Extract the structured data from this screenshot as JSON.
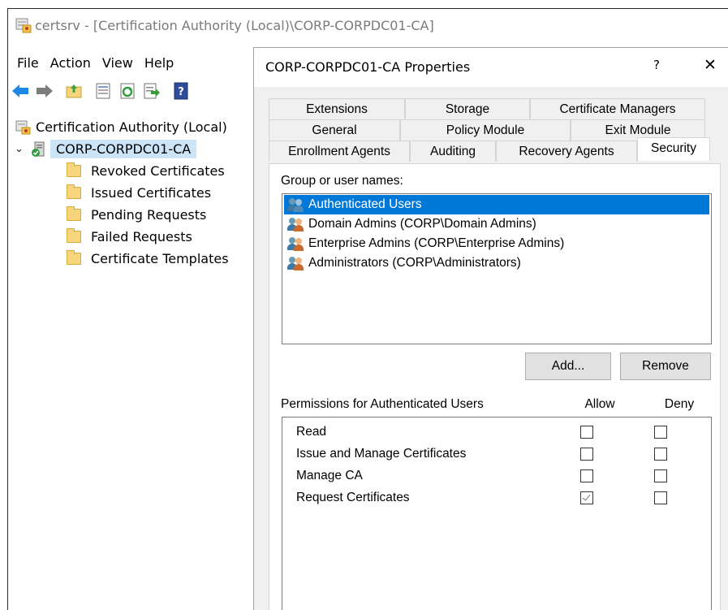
{
  "window": {
    "title": "certsrv - [Certification Authority (Local)\\CORP-CORPDC01-CA]",
    "icon": "certsrv-app-icon"
  },
  "menu": [
    "File",
    "Action",
    "View",
    "Help"
  ],
  "toolbar": {
    "icons": [
      "back-arrow-icon",
      "forward-arrow-icon",
      "up-folder-icon",
      "properties-icon",
      "refresh-icon",
      "export-list-icon",
      "help-icon"
    ]
  },
  "tree": {
    "root": "Certification Authority (Local)",
    "ca": "CORP-CORPDC01-CA",
    "folders": [
      "Revoked Certificates",
      "Issued Certificates",
      "Pending Requests",
      "Failed Requests",
      "Certificate Templates"
    ]
  },
  "dialog": {
    "title": "CORP-CORPDC01-CA Properties",
    "help_label": "?",
    "close_label": "✕",
    "tabs": {
      "row1": [
        "Extensions",
        "Storage",
        "Certificate Managers"
      ],
      "row2": [
        "General",
        "Policy Module",
        "Exit Module"
      ],
      "row3": [
        "Enrollment Agents",
        "Auditing",
        "Recovery Agents",
        "Security"
      ],
      "active": "Security"
    },
    "security": {
      "group_label": "Group or user names:",
      "users": [
        {
          "name": "Authenticated Users",
          "selected": true
        },
        {
          "name": "Domain Admins (CORP\\Domain Admins)",
          "selected": false
        },
        {
          "name": "Enterprise Admins (CORP\\Enterprise Admins)",
          "selected": false
        },
        {
          "name": "Administrators (CORP\\Administrators)",
          "selected": false
        }
      ],
      "add_label": "Add...",
      "remove_label": "Remove",
      "permissions_label": "Permissions for Authenticated Users",
      "allow_label": "Allow",
      "deny_label": "Deny",
      "permissions": [
        {
          "name": "Read",
          "allow": false,
          "deny": false
        },
        {
          "name": "Issue and Manage Certificates",
          "allow": false,
          "deny": false
        },
        {
          "name": "Manage CA",
          "allow": false,
          "deny": false
        },
        {
          "name": "Request Certificates",
          "allow": true,
          "deny": false
        }
      ]
    }
  },
  "colors": {
    "selection": "#0078d7",
    "tree_selection": "#cce4f7",
    "dialog_bg": "#f0f0f0"
  }
}
